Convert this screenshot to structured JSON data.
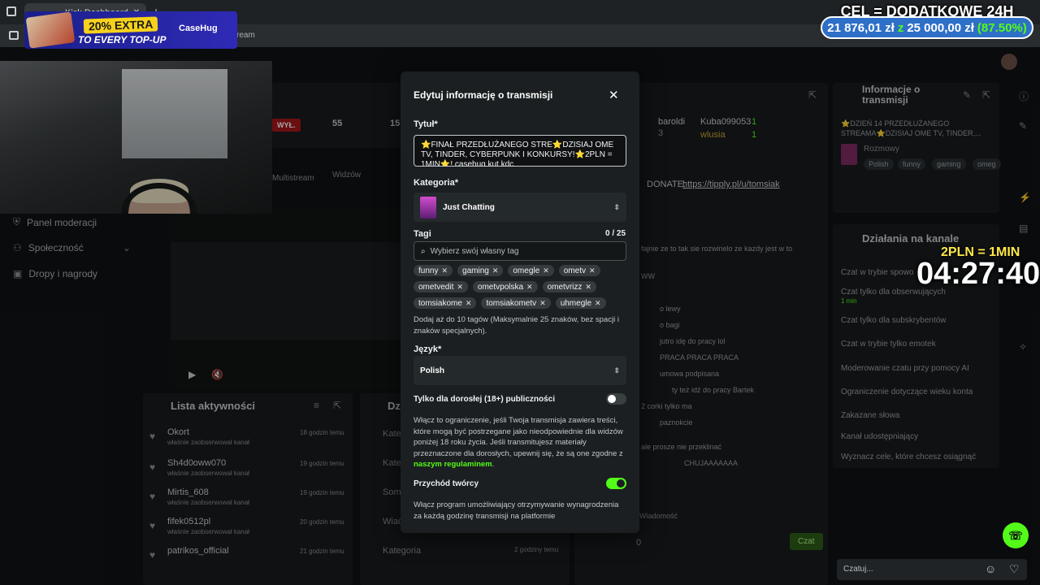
{
  "browser": {
    "tab_title": "Kick Dashboard",
    "tab_close": "✕",
    "new_tab": "+",
    "address_suffix": "ream"
  },
  "ad": {
    "extra": "20% EXTRA",
    "topup": "TO EVERY TOP-UP",
    "brand": "CaseHug"
  },
  "goal": {
    "title": "CEL = DODATKOWE 24H",
    "current": "21 876,01 zł",
    "of": "z",
    "target": "25 000,00 zł",
    "percent": "(87.50%)",
    "accent": "#53fc18"
  },
  "timer": {
    "label": "2PLN = 1MIN",
    "value": "04:27:40"
  },
  "sidebar": {
    "items": [
      {
        "label": "Panel moderacji",
        "icon": "shield-icon"
      },
      {
        "label": "Społeczność",
        "icon": "users-icon"
      },
      {
        "label": "Dropy i nagrody",
        "icon": "gift-icon"
      }
    ]
  },
  "stats": {
    "status_badge": "WYŁ.",
    "viewers_value": "55",
    "viewers_label": "Widzów",
    "multistream": "Multistream",
    "fifteen": "15"
  },
  "activity": {
    "title": "Lista aktywności",
    "items": [
      {
        "name": "Okort",
        "action": "właśnie zaobserwował kanał",
        "time": "18 godzin temu"
      },
      {
        "name": "Sh4d0oww070",
        "action": "właśnie zaobserwował kanał",
        "time": "19 godzin temu"
      },
      {
        "name": "Mirtis_608",
        "action": "właśnie zaobserwował kanał",
        "time": "19 godzin temu"
      },
      {
        "name": "fifek0512pl",
        "action": "właśnie zaobserwował kanał",
        "time": "20 godzin temu"
      },
      {
        "name": "patrikos_official",
        "action": "",
        "time": "21 godzin temu"
      }
    ]
  },
  "middle": {
    "title": "Dz",
    "rows": [
      "Kate",
      "Kate",
      "Some",
      "Wiad",
      "Kategoria"
    ],
    "row_time": "2 godziny temu"
  },
  "chat": {
    "top_users": [
      {
        "name": "baroldi",
        "count": "3"
      },
      {
        "name": "Kuba099053",
        "count": "1"
      },
      {
        "name": "wlusia",
        "count": "1"
      }
    ],
    "donate_prefix": "DONATE:",
    "donate_link": "https://tipply.pl/u/tomsiak",
    "messages": [
      "fajnie ze to tak sie rozwinelo ze kazdy jest w to",
      "WW",
      "o lewy",
      "o bagi",
      "jutro idę do pracy lol",
      "PRACA PRACA PRACA",
      "umowa podpisana",
      "ty też idź do pracy Bartek",
      "2 corki tylko ma",
      "paznokcie",
      "ale prosze nie przeklinać",
      "CHUJAAAAAAA"
    ],
    "input_placeholder": "Wiadomość",
    "send_button": "Czat",
    "points": "0",
    "side_input_placeholder": "Czatuj..."
  },
  "stream_info": {
    "title": "Informacje o transmisji",
    "stream_title_preview": "⭐DZIEŃ 14 PRZEDŁUŻANEGO STREAMA⭐DZISIAJ OME TV, TINDER,...",
    "category": "Rozmowy",
    "tags": [
      "Polish",
      "funny",
      "gaming",
      "omeg"
    ]
  },
  "actions": {
    "title": "Działania na kanale",
    "items": [
      {
        "label": "Czat w trybie spowo",
        "sub": ""
      },
      {
        "label": "Czat tylko dla obserwujących",
        "sub": "1 min"
      },
      {
        "label": "Czat tylko dla subskrybentów",
        "sub": ""
      },
      {
        "label": "Czat w trybie tylko emotek",
        "sub": ""
      },
      {
        "label": "Moderowanie czatu przy pomocy AI",
        "sub": ""
      },
      {
        "label": "Ograniczenie dotyczące wieku konta",
        "sub": ""
      },
      {
        "label": "Zakazane słowa",
        "sub": ""
      },
      {
        "label": "Kanał udostępniający",
        "sub": ""
      },
      {
        "label": "Wyznacz cele, które chcesz osiągnąć",
        "sub": ""
      }
    ]
  },
  "modal": {
    "title": "Edytuj informację o transmisji",
    "close": "✕",
    "title_label": "Tytuł*",
    "title_value": "⭐FINAŁ PRZEDŁUŻANEGO STRE⭐DZISIAJ OME TV, TINDER, CYBERPUNK I KONKURSY!⭐2PLN = 1MIN⭐! casehug kut kdc",
    "category_label": "Kategoria*",
    "category_value": "Just Chatting",
    "tags_label": "Tagi",
    "tags_count": "0 / 25",
    "tags_placeholder": "Wybierz swój własny tag",
    "tags": [
      "funny",
      "gaming",
      "omegle",
      "ometv",
      "ometvedit",
      "ometvpolska",
      "ometvrizz",
      "tomsiakome",
      "tomsiakometv",
      "uhmegle"
    ],
    "tags_help": "Dodaj aż do 10 tagów (Maksymalnie 25 znaków, bez spacji i znaków specjalnych).",
    "language_label": "Język*",
    "language_value": "Polish",
    "adult_label": "Tylko dla dorosłej (18+) publiczności",
    "adult_help_1": "Włącz to ograniczenie, jeśli Twoja transmisja zawiera treści, które mogą być postrzegane jako nieodpowiednie dla widzów poniżej 18 roku życia. Jeśli transmitujesz materiały przeznaczone dla dorosłych, upewnij się, że są one zgodne z",
    "adult_help_link": "naszym regulaminem",
    "adult_help_end": ".",
    "creator_label": "Przychód twórcy",
    "creator_help": "Włącz program umożliwiający otrzymywanie wynagrodzenia za każdą godzinę transmisji na platformie"
  }
}
